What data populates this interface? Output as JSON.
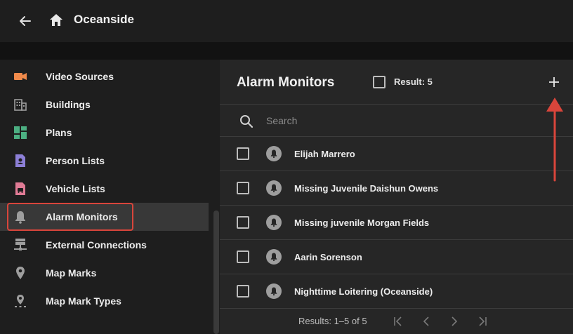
{
  "header": {
    "title": "Oceanside"
  },
  "sidebar": {
    "items": [
      {
        "label": "Video Sources",
        "icon": "video-camera-icon"
      },
      {
        "label": "Buildings",
        "icon": "building-icon"
      },
      {
        "label": "Plans",
        "icon": "dashboard-icon"
      },
      {
        "label": "Person Lists",
        "icon": "person-list-icon"
      },
      {
        "label": "Vehicle Lists",
        "icon": "vehicle-list-icon"
      },
      {
        "label": "Alarm Monitors",
        "icon": "bell-icon",
        "active": true
      },
      {
        "label": "External Connections",
        "icon": "network-icon"
      },
      {
        "label": "Map Marks",
        "icon": "map-pin-icon"
      },
      {
        "label": "Map Mark Types",
        "icon": "map-pin-type-icon"
      }
    ]
  },
  "panel": {
    "title": "Alarm Monitors",
    "result": "Result: 5",
    "search_placeholder": "Search",
    "rows": [
      {
        "name": "Elijah Marrero"
      },
      {
        "name": "Missing Juvenile Daishun Owens"
      },
      {
        "name": "Missing juvenile Morgan Fields"
      },
      {
        "name": "Aarin Sorenson"
      },
      {
        "name": "Nighttime Loitering (Oceanside)"
      }
    ],
    "pagination": "Results: 1–5 of 5"
  },
  "colors": {
    "accent_red": "#d9453b",
    "video_orange": "#f08a4b",
    "plans_green": "#4caf82",
    "person_purple": "#8c7fd6",
    "vehicle_pink": "#e07b95"
  }
}
